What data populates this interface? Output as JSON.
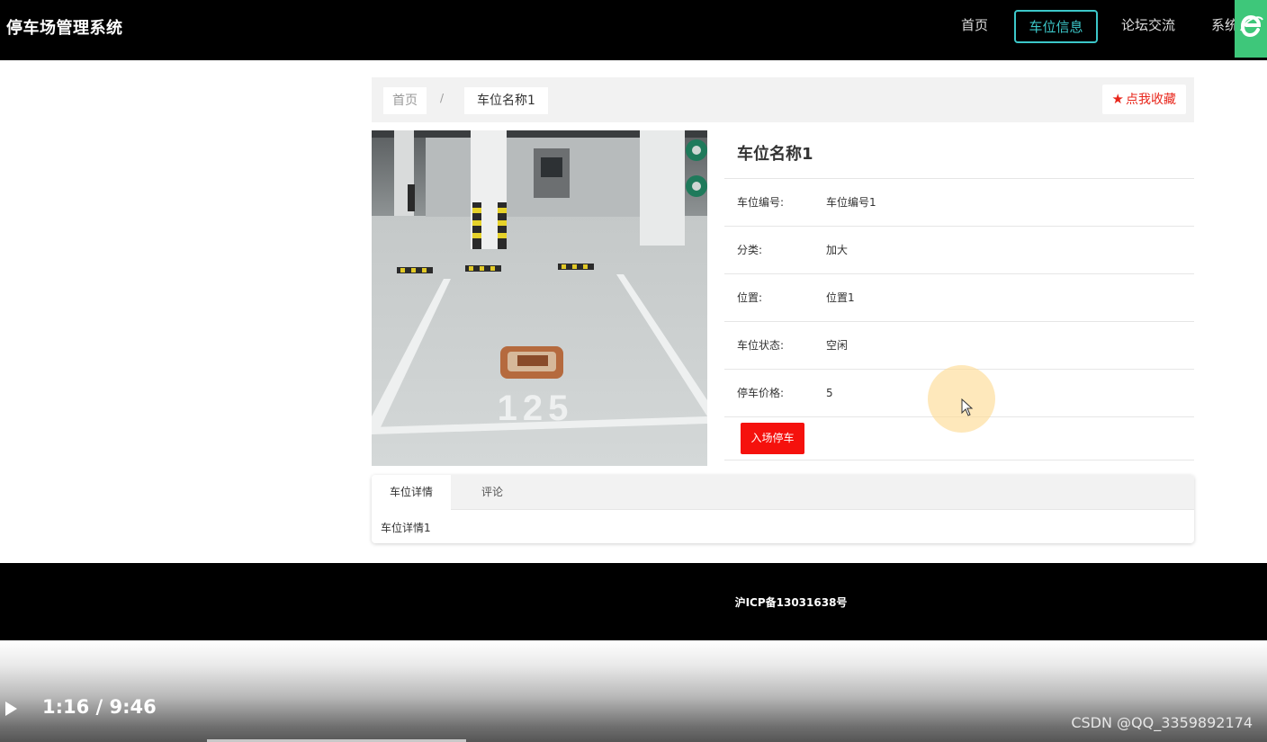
{
  "header": {
    "site_title": "停车场管理系统",
    "nav": [
      "首页",
      "车位信息",
      "论坛交流",
      "系统"
    ],
    "active_nav": "车位信息"
  },
  "breadcrumb": {
    "home": "首页",
    "separator": "/",
    "current": "车位名称1"
  },
  "favorite_button": "点我收藏",
  "detail": {
    "title": "车位名称1",
    "fields": [
      {
        "label": "车位编号:",
        "value": "车位编号1"
      },
      {
        "label": "分类:",
        "value": "加大"
      },
      {
        "label": "位置:",
        "value": "位置1"
      },
      {
        "label": "车位状态:",
        "value": "空闲"
      },
      {
        "label": "停车价格:",
        "value": "5"
      }
    ],
    "action_button": "入场停车"
  },
  "photo": {
    "painted_number": "125"
  },
  "tabs": {
    "items": [
      "车位详情",
      "评论"
    ],
    "active": "车位详情",
    "content": "车位详情1"
  },
  "footer": {
    "icp": "沪ICP备13031638号"
  },
  "video": {
    "time": "1:16 / 9:46",
    "watermark": "CSDN @QQ_3359892174"
  },
  "colors": {
    "accent": "#3cc7c9",
    "action_red": "#f5110d",
    "favorite_red": "#e8251a",
    "header_bg": "#000000"
  }
}
